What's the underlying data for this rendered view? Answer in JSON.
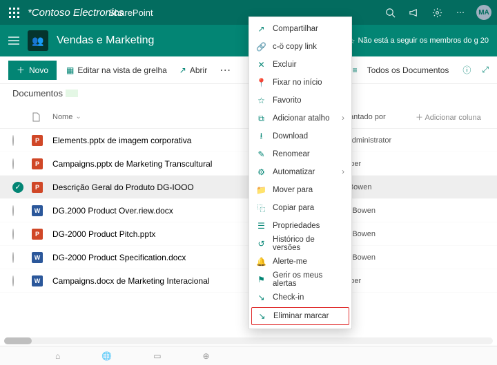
{
  "suite": {
    "brand": "*Contoso Electronics",
    "product": "SharePoint",
    "avatar": "MA"
  },
  "site": {
    "title": "Vendas e Marketing",
    "followText": "Não está a seguir os membros do g 20"
  },
  "commands": {
    "new": "Novo",
    "editInGrid": "Editar na vista de grelha",
    "open": "Abrir",
    "allDocs": "Todos os Documentos"
  },
  "library": {
    "title": "Documentos"
  },
  "columns": {
    "name": "Nome",
    "by": "levantado por",
    "add": "Adicionar coluna"
  },
  "rows": [
    {
      "icon": "ppt",
      "name": "Elements.pptx de imagem corporativa",
      "error": false,
      "by": "D Administrator",
      "selected": false
    },
    {
      "icon": "ppt",
      "name": "Campaigns.pptx de Marketing Transcultural",
      "error": true,
      "by": "Wilber",
      "selected": false
    },
    {
      "icon": "ppt",
      "name": "Descrição Geral do Produto DG-IOOO",
      "error": false,
      "by": "rn Bowen",
      "selected": true
    },
    {
      "icon": "doc",
      "name": "DG.2000 Product Over.riew.docx",
      "error": true,
      "by": "um Bowen",
      "selected": false
    },
    {
      "icon": "ppt",
      "name": "DG-2000 Product Pitch.pptx",
      "error": false,
      "by": "um Bowen",
      "selected": false
    },
    {
      "icon": "doc",
      "name": "DG-2000 Product Specification.docx",
      "error": false,
      "by": "um Bowen",
      "selected": false
    },
    {
      "icon": "doc",
      "name": "Campaigns.docx de Marketing Interacional",
      "error": false,
      "by": "Wilber",
      "selected": false
    }
  ],
  "contextMenu": [
    {
      "icon": "share",
      "label": "Compartilhar"
    },
    {
      "icon": "link",
      "label": "c-ö copy link"
    },
    {
      "icon": "delete",
      "label": "Excluir"
    },
    {
      "icon": "pin",
      "label": "Fixar no início"
    },
    {
      "icon": "star",
      "label": "Favorito"
    },
    {
      "icon": "shortcut",
      "label": "Adicionar atalho",
      "submenu": true
    },
    {
      "icon": "download",
      "label": "Download"
    },
    {
      "icon": "rename",
      "label": "Renomear"
    },
    {
      "icon": "flow",
      "label": "Automatizar",
      "submenu": true
    },
    {
      "icon": "move",
      "label": "Mover para"
    },
    {
      "icon": "copy",
      "label": "Copiar para"
    },
    {
      "icon": "props",
      "label": "Propriedades"
    },
    {
      "icon": "history",
      "label": "Histórico de versões"
    },
    {
      "icon": "alert",
      "label": "Alerte-me"
    },
    {
      "icon": "manage",
      "label": "Gerir os meus alertas"
    },
    {
      "icon": "checkin",
      "label": "Check-in"
    },
    {
      "icon": "discard",
      "label": "Eliminar marcar",
      "highlight": true
    }
  ]
}
